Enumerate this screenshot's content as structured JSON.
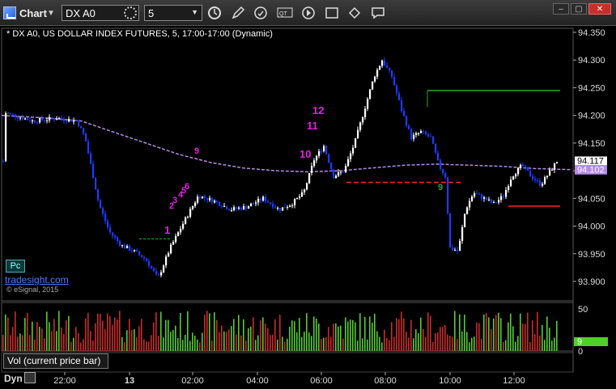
{
  "toolbar": {
    "app_title": "Chart",
    "symbol": "DX A0",
    "interval": "5",
    "icons": [
      "gear-icon",
      "clock-icon",
      "pencil-icon",
      "refresh-icon",
      "quote-icon",
      "play-icon",
      "eraser-icon",
      "link-icon",
      "comment-icon"
    ]
  },
  "chart": {
    "header": "* DX A0, US DOLLAR INDEX FUTURES, 5, 17:00-17:00 (Dynamic)",
    "price_ticks": [
      "94.350",
      "94.300",
      "94.250",
      "94.200",
      "94.150",
      "94.100",
      "94.050",
      "94.000",
      "93.950",
      "93.900"
    ],
    "current_price": "94.117",
    "ma_price": "94.102",
    "time_ticks": [
      "22:00",
      "13",
      "02:00",
      "04:00",
      "06:00",
      "08:00",
      "10:00",
      "12:00"
    ],
    "volume_ticks": [
      "50",
      "0"
    ],
    "current_volume": "9",
    "pc_button": "Pc",
    "logo": "tradesight.com",
    "copyright": "© eSignal, 2015",
    "volume_label": "Vol (current price bar)",
    "dyn_label": "Dyn",
    "count_labels": [
      "1",
      "2",
      "3",
      "4",
      "5",
      "6",
      "9",
      "10",
      "11",
      "12",
      "9"
    ]
  },
  "colors": {
    "up_bar": "#ffffff",
    "down_bar": "#1a3cff",
    "ma": "#b58ae6",
    "vol_up": "#55cc33",
    "vol_down": "#cc2a2a",
    "support": "#ff2222",
    "resistance": "#22aa22",
    "count": "#e020e0"
  }
}
